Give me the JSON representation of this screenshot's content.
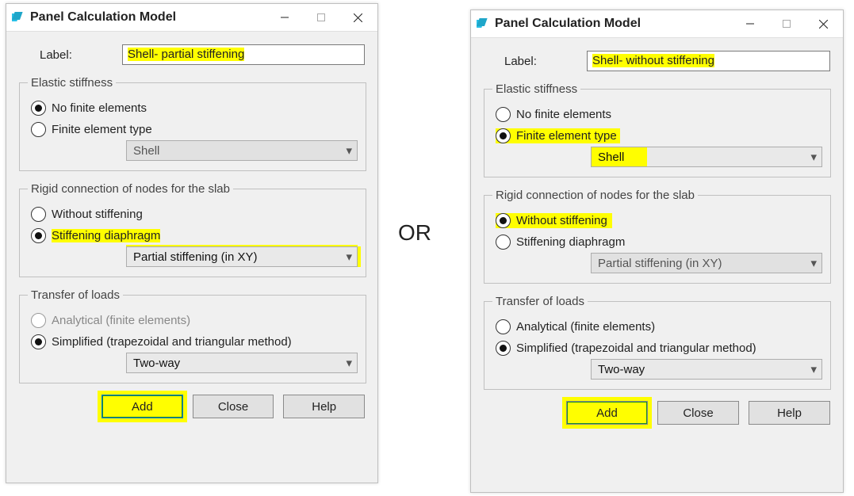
{
  "or_text": "OR",
  "left": {
    "title": "Panel Calculation Model",
    "label_caption": "Label:",
    "label_value": "Shell- partial stiffening",
    "group_elastic": "Elastic stiffness",
    "radio_no_fe": "No finite elements",
    "radio_fe_type": "Finite element type",
    "combo_fe": "Shell",
    "group_rigid": "Rigid connection of nodes for the slab",
    "radio_without": "Without stiffening",
    "radio_diaphragm": "Stiffening diaphragm",
    "combo_stiff": "Partial stiffening (in XY)",
    "group_transfer": "Transfer of loads",
    "radio_analytical": "Analytical (finite elements)",
    "radio_simplified": "Simplified (trapezoidal and triangular method)",
    "combo_load": "Two-way",
    "btn_add": "Add",
    "btn_close": "Close",
    "btn_help": "Help"
  },
  "right": {
    "title": "Panel Calculation Model",
    "label_caption": "Label:",
    "label_value": "Shell- without stiffening",
    "group_elastic": "Elastic stiffness",
    "radio_no_fe": "No finite elements",
    "radio_fe_type": "Finite element type",
    "combo_fe": "Shell",
    "group_rigid": "Rigid connection of nodes for the slab",
    "radio_without": "Without stiffening",
    "radio_diaphragm": "Stiffening diaphragm",
    "combo_stiff": "Partial stiffening (in XY)",
    "group_transfer": "Transfer of loads",
    "radio_analytical": "Analytical (finite elements)",
    "radio_simplified": "Simplified (trapezoidal and triangular method)",
    "combo_load": "Two-way",
    "btn_add": "Add",
    "btn_close": "Close",
    "btn_help": "Help"
  }
}
